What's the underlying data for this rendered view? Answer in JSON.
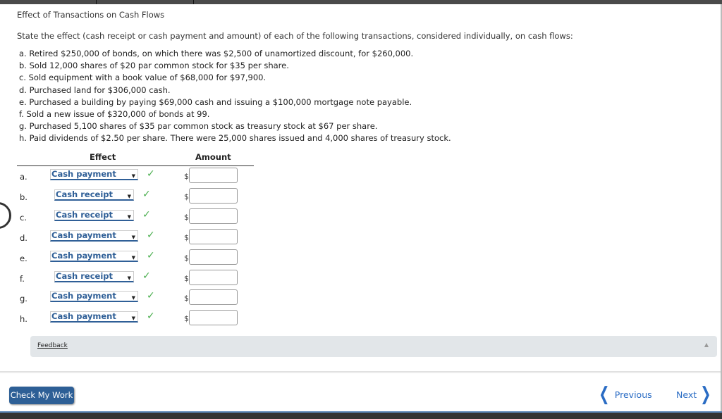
{
  "header": {
    "title": "Effect of Transactions on Cash Flows"
  },
  "instructions": "State the effect (cash receipt or cash payment and amount) of each of the following transactions, considered individually, on cash flows:",
  "transactions": [
    "a. Retired $250,000 of bonds, on which there was $2,500 of unamortized discount, for $260,000.",
    "b. Sold 12,000 shares of $20 par common stock for $35 per share.",
    "c. Sold equipment with a book value of $68,000 for $97,900.",
    "d. Purchased land for $306,000 cash.",
    "e. Purchased a building by paying $69,000 cash and issuing a $100,000 mortgage note payable.",
    "f. Sold a new issue of $320,000 of bonds at 99.",
    "g. Purchased 5,100 shares of $35 par common stock as treasury stock at $67 per share.",
    "h. Paid dividends of $2.50 per share. There were 25,000 shares issued and 4,000 shares of treasury stock."
  ],
  "table": {
    "headers": {
      "effect": "Effect",
      "amount": "Amount"
    },
    "currency_symbol": "$",
    "rows": [
      {
        "letter": "a.",
        "effect": "Cash payment",
        "correct": true,
        "amount": ""
      },
      {
        "letter": "b.",
        "effect": "Cash receipt",
        "correct": true,
        "amount": ""
      },
      {
        "letter": "c.",
        "effect": "Cash receipt",
        "correct": true,
        "amount": ""
      },
      {
        "letter": "d.",
        "effect": "Cash payment",
        "correct": true,
        "amount": ""
      },
      {
        "letter": "e.",
        "effect": "Cash payment",
        "correct": true,
        "amount": ""
      },
      {
        "letter": "f.",
        "effect": "Cash receipt",
        "correct": true,
        "amount": ""
      },
      {
        "letter": "g.",
        "effect": "Cash payment",
        "correct": true,
        "amount": ""
      },
      {
        "letter": "h.",
        "effect": "Cash payment",
        "correct": true,
        "amount": ""
      }
    ]
  },
  "feedback": {
    "label": "Feedback"
  },
  "footer": {
    "check_label": "Check My Work",
    "previous_label": "Previous",
    "next_label": "Next"
  },
  "icons": {
    "check": "✓",
    "dropdown": "▼",
    "collapse": "▲",
    "chev_left": "❮",
    "chev_right": "❯"
  },
  "colors": {
    "accent": "#2f5f97",
    "success": "#4caf50",
    "nav": "#2a6cc4"
  }
}
